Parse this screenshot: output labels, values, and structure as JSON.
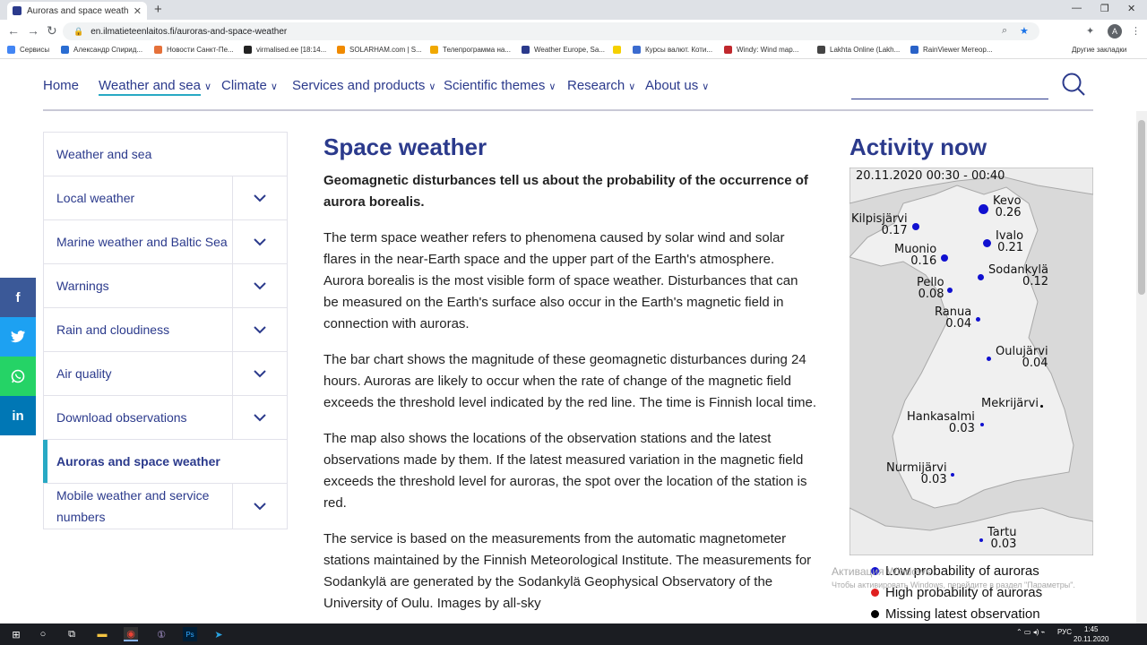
{
  "browser": {
    "tab_title": "Auroras and space weather - Finn",
    "url": "en.ilmatieteenlaitos.fi/auroras-and-space-weather",
    "avatar_initial": "A",
    "bookmarks": [
      {
        "label": "Сервисы",
        "color": "#4285f4"
      },
      {
        "label": "Александр Спирид...",
        "color": "#2a6dd2"
      },
      {
        "label": "Новости Санкт-Пе...",
        "color": "#e5713a"
      },
      {
        "label": "virmalised.ee [18:14...",
        "color": "#222222"
      },
      {
        "label": "SOLARHAM.com | S...",
        "color": "#f08a00"
      },
      {
        "label": "Телепрограмма на...",
        "color": "#f0a800"
      },
      {
        "label": "Weather Europe, Sa...",
        "color": "#2b3a8c"
      },
      {
        "label": "",
        "color": "#f5d000"
      },
      {
        "label": "Курсы валют. Коти...",
        "color": "#3b6bcf"
      },
      {
        "label": "Windy: Wind map...",
        "color": "#c0282d"
      },
      {
        "label": "Lakhta Online (Lakh...",
        "color": "#444444"
      },
      {
        "label": "RainViewer Метеор...",
        "color": "#2962c8"
      }
    ],
    "other_bookmarks": "Другие закладки"
  },
  "nav": {
    "home": "Home",
    "weather_sea": "Weather and sea",
    "climate": "Climate",
    "services": "Services and products",
    "scientific": "Scientific themes",
    "research": "Research",
    "about": "About us"
  },
  "sidebar": {
    "items": [
      {
        "label": "Weather and sea",
        "expandable": false
      },
      {
        "label": "Local weather",
        "expandable": true
      },
      {
        "label": "Marine weather and Baltic Sea",
        "expandable": true
      },
      {
        "label": "Warnings",
        "expandable": true
      },
      {
        "label": "Rain and cloudiness",
        "expandable": true
      },
      {
        "label": "Air quality",
        "expandable": true
      },
      {
        "label": "Download observations",
        "expandable": true
      },
      {
        "label": "Auroras and space weather",
        "expandable": false,
        "active": true
      },
      {
        "label": "Mobile weather and service numbers",
        "expandable": true
      }
    ]
  },
  "social": [
    {
      "icon": "facebook-icon",
      "glyph": "f",
      "color": "#3b5998"
    },
    {
      "icon": "twitter-icon",
      "glyph": "🐦",
      "color": "#1da1f2"
    },
    {
      "icon": "whatsapp-icon",
      "glyph": "✆",
      "color": "#25d366"
    },
    {
      "icon": "linkedin-icon",
      "glyph": "in",
      "color": "#0077b5"
    }
  ],
  "main": {
    "title": "Space weather",
    "lead": "Geomagnetic disturbances tell us about the probability of the occurrence of aurora borealis.",
    "paragraphs": [
      "The term space weather refers to phenomena caused by solar wind and solar flares in the near-Earth space and the upper part of the Earth's atmosphere. Aurora borealis is the most visible form of space weather. Disturbances that can be measured on the Earth's surface also occur in the Earth's magnetic field in connection with auroras.",
      "The bar chart shows the magnitude of these geomagnetic disturbances during 24 hours. Auroras are likely to occur when the rate of change of the magnetic field exceeds the threshold level indicated by the red line. The time is Finnish local time.",
      "The map also shows the locations of the observation stations and the latest observations made by them. If the latest measured variation in the magnetic field exceeds the threshold level for auroras, the spot over the location of the station is red.",
      "The service is based on the measurements from the automatic magnetometer stations maintained by the Finnish Meteorological Institute. The measurements for Sodankylä are generated by the Sodankylä Geophysical Observatory of the University of Oulu. Images by all-sky"
    ]
  },
  "activity": {
    "title": "Activity now",
    "date": "20.11.2020 00:30 - 00:40",
    "stations": [
      {
        "name": "Kevo",
        "value": "0.26",
        "status": "low"
      },
      {
        "name": "Kilpisjärvi",
        "value": "0.17",
        "status": "low"
      },
      {
        "name": "Ivalo",
        "value": "0.21",
        "status": "low"
      },
      {
        "name": "Muonio",
        "value": "0.16",
        "status": "low"
      },
      {
        "name": "Sodankylä",
        "value": "0.12",
        "status": "low"
      },
      {
        "name": "Pello",
        "value": "0.08",
        "status": "low"
      },
      {
        "name": "Ranua",
        "value": "0.04",
        "status": "low"
      },
      {
        "name": "Oulujärvi",
        "value": "0.04",
        "status": "low"
      },
      {
        "name": "Mekrijärvi",
        "value": "",
        "status": "missing"
      },
      {
        "name": "Hankasalmi",
        "value": "0.03",
        "status": "low"
      },
      {
        "name": "Nurmijärvi",
        "value": "0.03",
        "status": "low"
      },
      {
        "name": "Tartu",
        "value": "0.03",
        "status": "low"
      }
    ],
    "legend": [
      {
        "label": "Low probability of auroras",
        "color": "#1010d0"
      },
      {
        "label": "High probability of auroras",
        "color": "#e02020"
      },
      {
        "label": "Missing latest observation",
        "color": "#000000"
      }
    ],
    "watermark_1": "Активация Windows",
    "watermark_2": "Чтобы активировать Windows, перейдите в раздел \"Параметры\"."
  },
  "taskbar": {
    "lang": "РУС",
    "time": "1:45",
    "date": "20.11.2020"
  }
}
